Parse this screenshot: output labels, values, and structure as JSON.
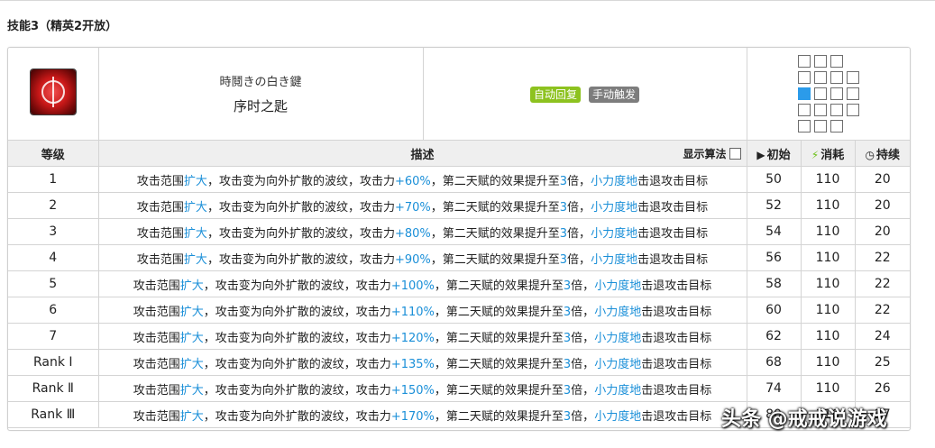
{
  "section_title": "技能3（精英2开放）",
  "skill": {
    "icon": "skill-key-icon",
    "name_jp": "時鬩きの白き鍵",
    "name_cn": "序时之匙",
    "badges": [
      "自动回复",
      "手动触发"
    ]
  },
  "range_grid": [
    [
      1,
      1,
      1,
      0
    ],
    [
      1,
      1,
      1,
      1
    ],
    [
      2,
      1,
      1,
      1
    ],
    [
      1,
      1,
      1,
      1
    ],
    [
      1,
      1,
      1,
      0
    ]
  ],
  "columns": {
    "level": "等级",
    "description": "描述",
    "show_algo": "显示算法",
    "initial": "初始",
    "cost": "消耗",
    "duration": "持续"
  },
  "desc_parts": {
    "p1": "攻击范围",
    "expand": "扩大",
    "p2": "，攻击变为向外扩散的波纹，攻击力",
    "p3": "，第二天赋的效果提升至",
    "times": "3",
    "p4": "倍，",
    "force": "小力度地",
    "p5": "击退攻击目标"
  },
  "rows": [
    {
      "level": "1",
      "atk": "+60%",
      "initial": "50",
      "cost": "110",
      "duration": "20"
    },
    {
      "level": "2",
      "atk": "+70%",
      "initial": "52",
      "cost": "110",
      "duration": "20"
    },
    {
      "level": "3",
      "atk": "+80%",
      "initial": "54",
      "cost": "110",
      "duration": "20"
    },
    {
      "level": "4",
      "atk": "+90%",
      "initial": "56",
      "cost": "110",
      "duration": "22"
    },
    {
      "level": "5",
      "atk": "+100%",
      "initial": "58",
      "cost": "110",
      "duration": "22"
    },
    {
      "level": "6",
      "atk": "+110%",
      "initial": "60",
      "cost": "110",
      "duration": "22"
    },
    {
      "level": "7",
      "atk": "+120%",
      "initial": "62",
      "cost": "110",
      "duration": "24"
    },
    {
      "level": "Rank Ⅰ",
      "atk": "+135%",
      "initial": "68",
      "cost": "110",
      "duration": "25"
    },
    {
      "level": "Rank Ⅱ",
      "atk": "+150%",
      "initial": "74",
      "cost": "110",
      "duration": "26"
    },
    {
      "level": "Rank Ⅲ",
      "atk": "+170%",
      "initial": "80",
      "cost": "110",
      "duration": "27"
    }
  ],
  "watermark": "头条 @戒戒说游戏",
  "colors": {
    "highlight": "#1a8fd8",
    "badge_auto": "#8dc21f",
    "badge_manual": "#7d7d7d",
    "range_self": "#2b9bea"
  }
}
